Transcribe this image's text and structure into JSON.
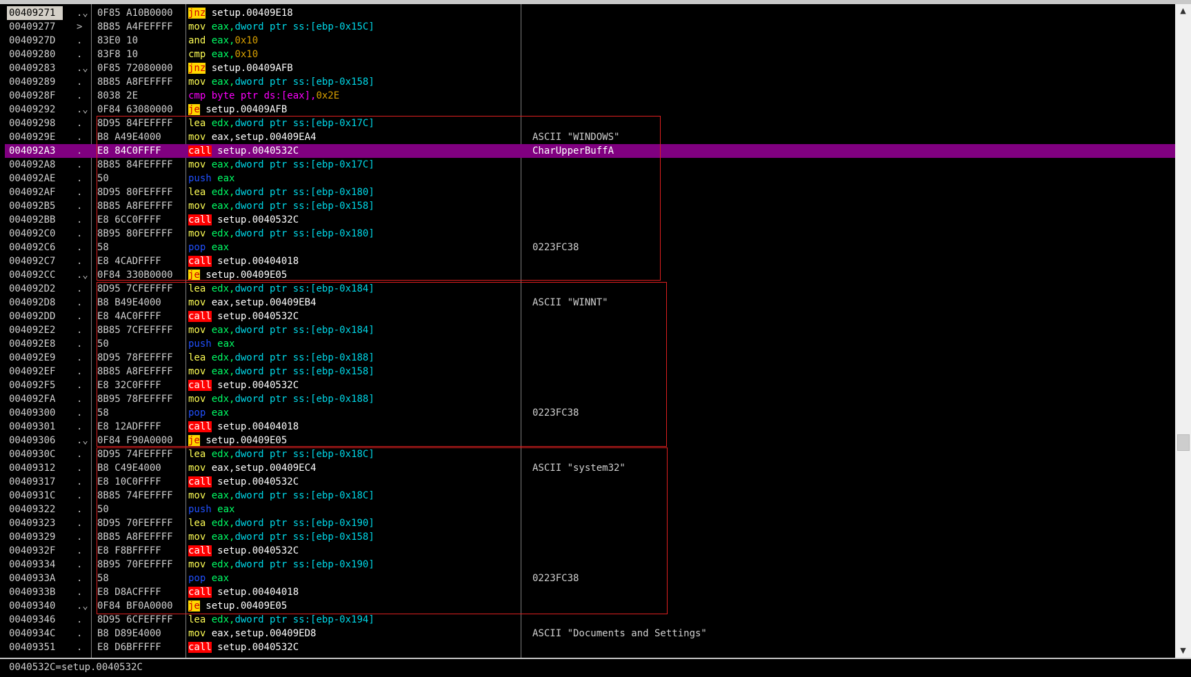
{
  "rows": [
    {
      "addr": "00409271",
      "arr": ".⌄",
      "hex": "0F85 A10B0000",
      "tokens": [
        [
          "jnz",
          "jcc"
        ],
        [
          " setup.00409E18",
          "plain"
        ]
      ],
      "cmt": "",
      "sel": true
    },
    {
      "addr": "00409277",
      "arr": ">",
      "hex": "8B85 A4FEFFFF",
      "tokens": [
        [
          "mov",
          "mov"
        ],
        [
          " eax,",
          "reg"
        ],
        [
          "dword ptr ss:[ebp-0x15C]",
          "mem"
        ]
      ],
      "cmt": ""
    },
    {
      "addr": "0040927D",
      "arr": ".",
      "hex": "83E0 10",
      "tokens": [
        [
          "and",
          "and"
        ],
        [
          " eax,",
          "reg"
        ],
        [
          "0x10",
          "num"
        ]
      ],
      "cmt": ""
    },
    {
      "addr": "00409280",
      "arr": ".",
      "hex": "83F8 10",
      "tokens": [
        [
          "cmp",
          "cmp"
        ],
        [
          " eax,",
          "reg"
        ],
        [
          "0x10",
          "num"
        ]
      ],
      "cmt": ""
    },
    {
      "addr": "00409283",
      "arr": ".⌄",
      "hex": "0F85 72080000",
      "tokens": [
        [
          "jnz",
          "jcc"
        ],
        [
          " setup.00409AFB",
          "plain"
        ]
      ],
      "cmt": ""
    },
    {
      "addr": "00409289",
      "arr": ".",
      "hex": "8B85 A8FEFFFF",
      "tokens": [
        [
          "mov",
          "mov"
        ],
        [
          " eax,",
          "reg"
        ],
        [
          "dword ptr ss:[ebp-0x158]",
          "mem"
        ]
      ],
      "cmt": ""
    },
    {
      "addr": "0040928F",
      "arr": ".",
      "hex": "8038 2E",
      "tokens": [
        [
          "cmp",
          "cmpw"
        ],
        [
          " byte ptr ds:[eax],",
          "kw"
        ],
        [
          "0x2E",
          "num"
        ]
      ],
      "cmt": ""
    },
    {
      "addr": "00409292",
      "arr": ".⌄",
      "hex": "0F84 63080000",
      "tokens": [
        [
          "je",
          "jcc"
        ],
        [
          " setup.00409AFB",
          "plain"
        ]
      ],
      "cmt": ""
    },
    {
      "addr": "00409298",
      "arr": ".",
      "hex": "8D95 84FEFFFF",
      "tokens": [
        [
          "lea",
          "lea"
        ],
        [
          " edx,",
          "reg"
        ],
        [
          "dword ptr ss:[ebp-0x17C]",
          "mem"
        ]
      ],
      "cmt": ""
    },
    {
      "addr": "0040929E",
      "arr": ".",
      "hex": "B8 A49E4000",
      "tokens": [
        [
          "mov",
          "mov"
        ],
        [
          " eax,setup.00409EA4",
          "plain"
        ]
      ],
      "cmt": "ASCII \"WINDOWS\""
    },
    {
      "addr": "004092A3",
      "arr": ".",
      "hex": "E8 84C0FFFF",
      "tokens": [
        [
          "call",
          "call"
        ],
        [
          " setup.0040532C",
          "plain"
        ]
      ],
      "cmt": "CharUpperBuffA",
      "hl": true
    },
    {
      "addr": "004092A8",
      "arr": ".",
      "hex": "8B85 84FEFFFF",
      "tokens": [
        [
          "mov",
          "mov"
        ],
        [
          " eax,",
          "reg"
        ],
        [
          "dword ptr ss:[ebp-0x17C]",
          "mem"
        ]
      ],
      "cmt": ""
    },
    {
      "addr": "004092AE",
      "arr": ".",
      "hex": "50",
      "tokens": [
        [
          "push",
          "push"
        ],
        [
          " eax",
          "reg"
        ]
      ],
      "cmt": ""
    },
    {
      "addr": "004092AF",
      "arr": ".",
      "hex": "8D95 80FEFFFF",
      "tokens": [
        [
          "lea",
          "lea"
        ],
        [
          " edx,",
          "reg"
        ],
        [
          "dword ptr ss:[ebp-0x180]",
          "mem"
        ]
      ],
      "cmt": ""
    },
    {
      "addr": "004092B5",
      "arr": ".",
      "hex": "8B85 A8FEFFFF",
      "tokens": [
        [
          "mov",
          "mov"
        ],
        [
          " eax,",
          "reg"
        ],
        [
          "dword ptr ss:[ebp-0x158]",
          "mem"
        ]
      ],
      "cmt": ""
    },
    {
      "addr": "004092BB",
      "arr": ".",
      "hex": "E8 6CC0FFFF",
      "tokens": [
        [
          "call",
          "call"
        ],
        [
          " setup.0040532C",
          "plain"
        ]
      ],
      "cmt": ""
    },
    {
      "addr": "004092C0",
      "arr": ".",
      "hex": "8B95 80FEFFFF",
      "tokens": [
        [
          "mov",
          "mov"
        ],
        [
          " edx,",
          "reg"
        ],
        [
          "dword ptr ss:[ebp-0x180]",
          "mem"
        ]
      ],
      "cmt": ""
    },
    {
      "addr": "004092C6",
      "arr": ".",
      "hex": "58",
      "tokens": [
        [
          "pop",
          "pop"
        ],
        [
          " eax",
          "reg"
        ]
      ],
      "cmt": "0223FC38"
    },
    {
      "addr": "004092C7",
      "arr": ".",
      "hex": "E8 4CADFFFF",
      "tokens": [
        [
          "call",
          "call"
        ],
        [
          " setup.00404018",
          "plain"
        ]
      ],
      "cmt": ""
    },
    {
      "addr": "004092CC",
      "arr": ".⌄",
      "hex": "0F84 330B0000",
      "tokens": [
        [
          "je",
          "jcc"
        ],
        [
          " setup.00409E05",
          "plain"
        ]
      ],
      "cmt": ""
    },
    {
      "addr": "004092D2",
      "arr": ".",
      "hex": "8D95 7CFEFFFF",
      "tokens": [
        [
          "lea",
          "lea"
        ],
        [
          " edx,",
          "reg"
        ],
        [
          "dword ptr ss:[ebp-0x184]",
          "mem"
        ]
      ],
      "cmt": ""
    },
    {
      "addr": "004092D8",
      "arr": ".",
      "hex": "B8 B49E4000",
      "tokens": [
        [
          "mov",
          "mov"
        ],
        [
          " eax,setup.00409EB4",
          "plain"
        ]
      ],
      "cmt": "ASCII \"WINNT\""
    },
    {
      "addr": "004092DD",
      "arr": ".",
      "hex": "E8 4AC0FFFF",
      "tokens": [
        [
          "call",
          "call"
        ],
        [
          " setup.0040532C",
          "plain"
        ]
      ],
      "cmt": ""
    },
    {
      "addr": "004092E2",
      "arr": ".",
      "hex": "8B85 7CFEFFFF",
      "tokens": [
        [
          "mov",
          "mov"
        ],
        [
          " eax,",
          "reg"
        ],
        [
          "dword ptr ss:[ebp-0x184]",
          "mem"
        ]
      ],
      "cmt": ""
    },
    {
      "addr": "004092E8",
      "arr": ".",
      "hex": "50",
      "tokens": [
        [
          "push",
          "push"
        ],
        [
          " eax",
          "reg"
        ]
      ],
      "cmt": ""
    },
    {
      "addr": "004092E9",
      "arr": ".",
      "hex": "8D95 78FEFFFF",
      "tokens": [
        [
          "lea",
          "lea"
        ],
        [
          " edx,",
          "reg"
        ],
        [
          "dword ptr ss:[ebp-0x188]",
          "mem"
        ]
      ],
      "cmt": ""
    },
    {
      "addr": "004092EF",
      "arr": ".",
      "hex": "8B85 A8FEFFFF",
      "tokens": [
        [
          "mov",
          "mov"
        ],
        [
          " eax,",
          "reg"
        ],
        [
          "dword ptr ss:[ebp-0x158]",
          "mem"
        ]
      ],
      "cmt": ""
    },
    {
      "addr": "004092F5",
      "arr": ".",
      "hex": "E8 32C0FFFF",
      "tokens": [
        [
          "call",
          "call"
        ],
        [
          " setup.0040532C",
          "plain"
        ]
      ],
      "cmt": ""
    },
    {
      "addr": "004092FA",
      "arr": ".",
      "hex": "8B95 78FEFFFF",
      "tokens": [
        [
          "mov",
          "mov"
        ],
        [
          " edx,",
          "reg"
        ],
        [
          "dword ptr ss:[ebp-0x188]",
          "mem"
        ]
      ],
      "cmt": ""
    },
    {
      "addr": "00409300",
      "arr": ".",
      "hex": "58",
      "tokens": [
        [
          "pop",
          "pop"
        ],
        [
          " eax",
          "reg"
        ]
      ],
      "cmt": "0223FC38"
    },
    {
      "addr": "00409301",
      "arr": ".",
      "hex": "E8 12ADFFFF",
      "tokens": [
        [
          "call",
          "call"
        ],
        [
          " setup.00404018",
          "plain"
        ]
      ],
      "cmt": ""
    },
    {
      "addr": "00409306",
      "arr": ".⌄",
      "hex": "0F84 F90A0000",
      "tokens": [
        [
          "je",
          "jcc"
        ],
        [
          " setup.00409E05",
          "plain"
        ]
      ],
      "cmt": ""
    },
    {
      "addr": "0040930C",
      "arr": ".",
      "hex": "8D95 74FEFFFF",
      "tokens": [
        [
          "lea",
          "lea"
        ],
        [
          " edx,",
          "reg"
        ],
        [
          "dword ptr ss:[ebp-0x18C]",
          "mem"
        ]
      ],
      "cmt": ""
    },
    {
      "addr": "00409312",
      "arr": ".",
      "hex": "B8 C49E4000",
      "tokens": [
        [
          "mov",
          "mov"
        ],
        [
          " eax,setup.00409EC4",
          "plain"
        ]
      ],
      "cmt": "ASCII \"system32\""
    },
    {
      "addr": "00409317",
      "arr": ".",
      "hex": "E8 10C0FFFF",
      "tokens": [
        [
          "call",
          "call"
        ],
        [
          " setup.0040532C",
          "plain"
        ]
      ],
      "cmt": ""
    },
    {
      "addr": "0040931C",
      "arr": ".",
      "hex": "8B85 74FEFFFF",
      "tokens": [
        [
          "mov",
          "mov"
        ],
        [
          " eax,",
          "reg"
        ],
        [
          "dword ptr ss:[ebp-0x18C]",
          "mem"
        ]
      ],
      "cmt": ""
    },
    {
      "addr": "00409322",
      "arr": ".",
      "hex": "50",
      "tokens": [
        [
          "push",
          "push"
        ],
        [
          " eax",
          "reg"
        ]
      ],
      "cmt": ""
    },
    {
      "addr": "00409323",
      "arr": ".",
      "hex": "8D95 70FEFFFF",
      "tokens": [
        [
          "lea",
          "lea"
        ],
        [
          " edx,",
          "reg"
        ],
        [
          "dword ptr ss:[ebp-0x190]",
          "mem"
        ]
      ],
      "cmt": ""
    },
    {
      "addr": "00409329",
      "arr": ".",
      "hex": "8B85 A8FEFFFF",
      "tokens": [
        [
          "mov",
          "mov"
        ],
        [
          " eax,",
          "reg"
        ],
        [
          "dword ptr ss:[ebp-0x158]",
          "mem"
        ]
      ],
      "cmt": ""
    },
    {
      "addr": "0040932F",
      "arr": ".",
      "hex": "E8 F8BFFFFF",
      "tokens": [
        [
          "call",
          "call"
        ],
        [
          " setup.0040532C",
          "plain"
        ]
      ],
      "cmt": ""
    },
    {
      "addr": "00409334",
      "arr": ".",
      "hex": "8B95 70FEFFFF",
      "tokens": [
        [
          "mov",
          "mov"
        ],
        [
          " edx,",
          "reg"
        ],
        [
          "dword ptr ss:[ebp-0x190]",
          "mem"
        ]
      ],
      "cmt": ""
    },
    {
      "addr": "0040933A",
      "arr": ".",
      "hex": "58",
      "tokens": [
        [
          "pop",
          "pop"
        ],
        [
          " eax",
          "reg"
        ]
      ],
      "cmt": "0223FC38"
    },
    {
      "addr": "0040933B",
      "arr": ".",
      "hex": "E8 D8ACFFFF",
      "tokens": [
        [
          "call",
          "call"
        ],
        [
          " setup.00404018",
          "plain"
        ]
      ],
      "cmt": ""
    },
    {
      "addr": "00409340",
      "arr": ".⌄",
      "hex": "0F84 BF0A0000",
      "tokens": [
        [
          "je",
          "jcc"
        ],
        [
          " setup.00409E05",
          "plain"
        ]
      ],
      "cmt": ""
    },
    {
      "addr": "00409346",
      "arr": ".",
      "hex": "8D95 6CFEFFFF",
      "tokens": [
        [
          "lea",
          "lea"
        ],
        [
          " edx,",
          "reg"
        ],
        [
          "dword ptr ss:[ebp-0x194]",
          "mem"
        ]
      ],
      "cmt": ""
    },
    {
      "addr": "0040934C",
      "arr": ".",
      "hex": "B8 D89E4000",
      "tokens": [
        [
          "mov",
          "mov"
        ],
        [
          " eax,setup.00409ED8",
          "plain"
        ]
      ],
      "cmt": "ASCII \"Documents and Settings\""
    },
    {
      "addr": "00409351",
      "arr": ".",
      "hex": "E8 D6BFFFFF",
      "tokens": [
        [
          "call",
          "call"
        ],
        [
          " setup.0040532C",
          "plain"
        ]
      ],
      "cmt": ""
    }
  ],
  "status_text": "0040532C=setup.0040532C",
  "scroll": {
    "up_icon": "scroll-up-arrow",
    "down_icon": "scroll-down-arrow",
    "up_glyph": "▲",
    "down_glyph": "▼"
  },
  "colors": {
    "highlight_row": "#800080",
    "box": "#e02020",
    "jcc_bg": "#ffd800",
    "call_bg": "#ff0000"
  }
}
